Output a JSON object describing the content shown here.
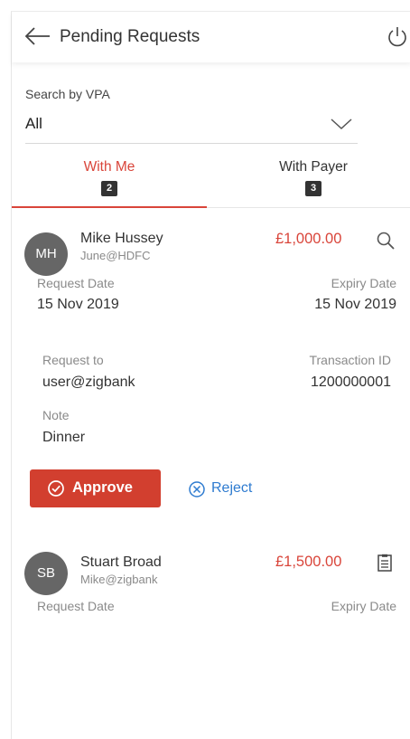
{
  "header": {
    "title": "Pending Requests",
    "back_icon": "arrow-left-icon",
    "power_icon": "power-icon"
  },
  "search": {
    "label": "Search by VPA",
    "selected": "All"
  },
  "tabs": [
    {
      "label": "With Me",
      "count": "2"
    },
    {
      "label": "With Payer",
      "count": "3"
    }
  ],
  "colors": {
    "accent": "#d9453a",
    "approve": "#d23f2f",
    "reject": "#2e7bd0",
    "avatar": "#666666"
  },
  "requests": [
    {
      "initials": "MH",
      "name": "Mike Hussey",
      "vpa": "June@HDFC",
      "amount": "£1,000.00",
      "action_icon": "search-icon",
      "request_date_label": "Request Date",
      "request_date": "15 Nov 2019",
      "expiry_date_label": "Expiry Date",
      "expiry_date": "15 Nov 2019",
      "request_to_label": "Request to",
      "request_to": "user@zigbank",
      "txn_label": "Transaction ID",
      "txn_id": "1200000001",
      "note_label": "Note",
      "note": "Dinner",
      "approve_label": "Approve",
      "reject_label": "Reject"
    },
    {
      "initials": "SB",
      "name": "Stuart Broad",
      "vpa": "Mike@zigbank",
      "amount": "£1,500.00",
      "action_icon": "clipboard-icon",
      "request_date_label": "Request Date",
      "expiry_date_label": "Expiry Date"
    }
  ]
}
